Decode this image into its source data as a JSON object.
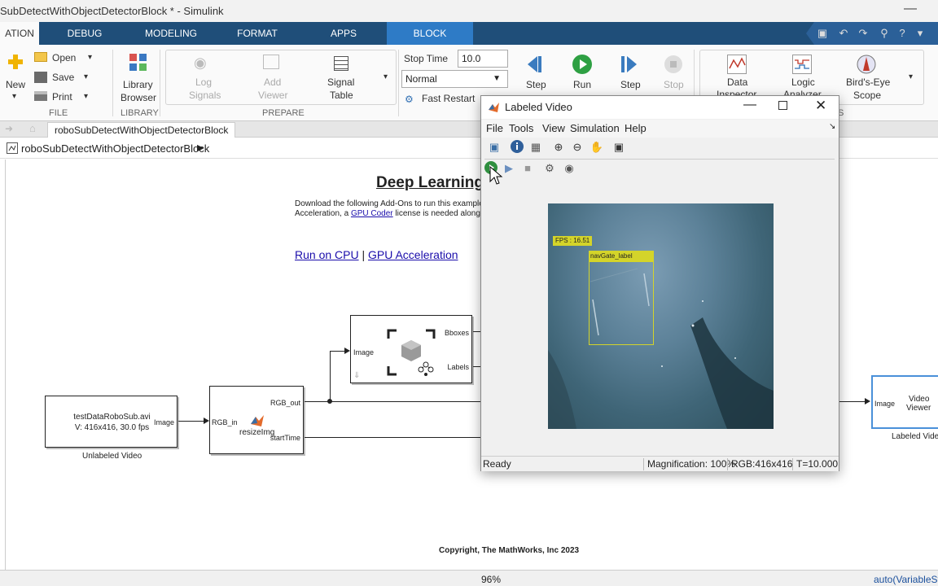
{
  "window": {
    "title": "SubDetectWithObjectDetectorBlock * - Simulink",
    "minimize": "—"
  },
  "tabs": [
    {
      "label": "ATION"
    },
    {
      "label": "DEBUG"
    },
    {
      "label": "MODELING"
    },
    {
      "label": "FORMAT"
    },
    {
      "label": "APPS"
    },
    {
      "label": "BLOCK"
    }
  ],
  "ribbon": {
    "file": {
      "new": "New",
      "open": "Open",
      "save": "Save",
      "print": "Print",
      "group": "FILE"
    },
    "library": {
      "browser_line1": "Library",
      "browser_line2": "Browser",
      "group": "LIBRARY"
    },
    "prepare": {
      "log_signals_1": "Log",
      "log_signals_2": "Signals",
      "add_viewer_1": "Add",
      "add_viewer_2": "Viewer",
      "signal_table_1": "Signal",
      "signal_table_2": "Table",
      "group": "PREPARE"
    },
    "simulate": {
      "stop_time_label": "Stop Time",
      "stop_time_value": "10.0",
      "mode_value": "Normal",
      "fast_restart": "Fast Restart",
      "step_back": "Step",
      "run": "Run",
      "step_forward": "Step",
      "stop": "Stop"
    },
    "review": {
      "data_inspector_1": "Data",
      "data_inspector_2": "Inspector",
      "logic_analyzer_1": "Logic",
      "logic_analyzer_2": "Analyzer",
      "birds_eye_1": "Bird's-Eye",
      "birds_eye_2": "Scope",
      "group_fragment": "S"
    }
  },
  "model_tab": "roboSubDetectWithObjectDetectorBlock",
  "breadcrumb": "roboSubDetectWithObjectDetectorBlock",
  "canvas": {
    "heading": "Deep Learning",
    "desc_line1": "Download the following Add-Ons to run this example -",
    "desc_line2_prefix": "Acceleration, a",
    "desc_line2_link": "GPU Coder",
    "desc_line2_suffix": "license is needed along wi",
    "run_cpu": "Run on CPU",
    "link_sep": "|",
    "gpu_accel": "GPU Acceleration",
    "source_block": {
      "line1": "testDataRoboSub.avi",
      "line2": "V: 416x416, 30.0 fps",
      "port_out": "Image",
      "caption": "Unlabeled Video"
    },
    "resize_block": {
      "name": "resizeImg",
      "port_in": "RGB_in",
      "port_out1": "RGB_out",
      "port_out2": "startTime"
    },
    "detector_block": {
      "port_in": "Image",
      "port_out1": "Bboxes",
      "port_out2": "Labels"
    },
    "viewer_block": {
      "name_line1": "Video",
      "name_line2": "Viewer",
      "port_in": "Image",
      "caption": "Labeled Vide"
    },
    "copyright": "Copyright, The MathWorks, Inc 2023"
  },
  "status_bar": {
    "zoom": "96%",
    "solver": "auto(VariableSt"
  },
  "video_window": {
    "title": "Labeled Video",
    "menu": [
      "File",
      "Tools",
      "View",
      "Simulation",
      "Help"
    ],
    "overlay_fps": "FPS : 16.51",
    "overlay_label": "navGate_label",
    "status_ready": "Ready",
    "status_magnification": "Magnification: 100%",
    "status_rgb": "RGB:416x416",
    "status_time": "T=10.000"
  },
  "colors": {
    "tab_bar": "#1f4e79",
    "active_tab": "#2e7bc6",
    "bbox": "#d4d42a",
    "link": "#1a0dab"
  }
}
